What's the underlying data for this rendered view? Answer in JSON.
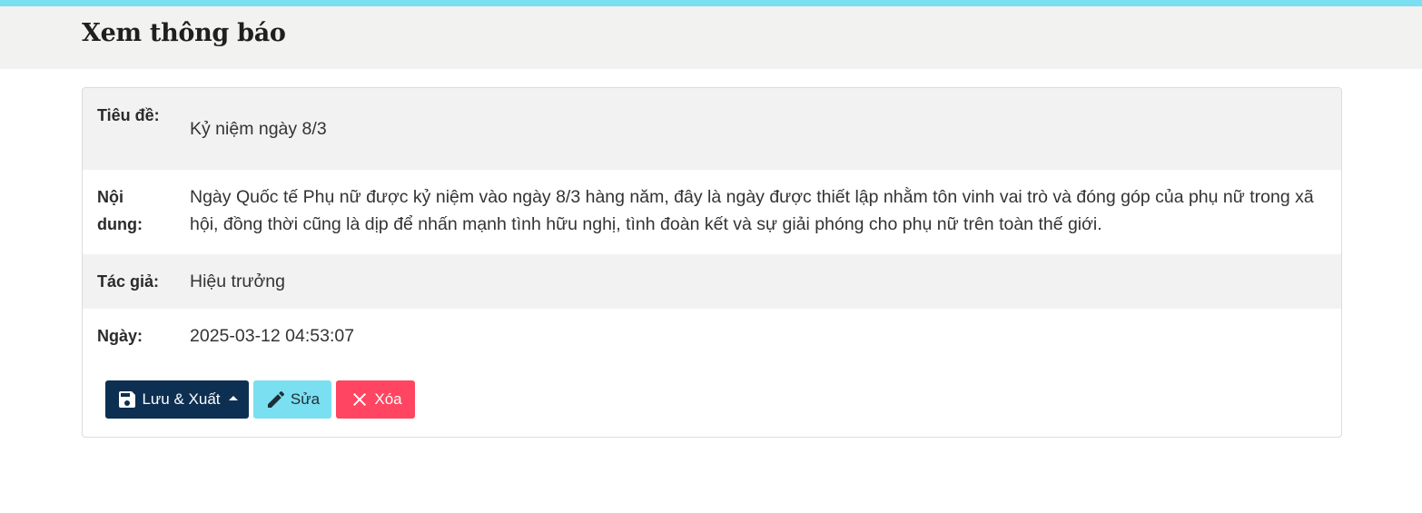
{
  "header": {
    "title": "Xem thông báo",
    "accent_color": "#7adff1"
  },
  "notice": {
    "rows": [
      {
        "label": "Tiêu đề:",
        "value": "Kỷ niệm ngày 8/3"
      },
      {
        "label": "Nội dung:",
        "value": "Ngày Quốc tế Phụ nữ được kỷ niệm vào ngày 8/3 hàng năm, đây là ngày được thiết lập nhằm tôn vinh vai trò và đóng góp của phụ nữ trong xã hội, đồng thời cũng là dịp để nhấn mạnh tình hữu nghị, tình đoàn kết và sự giải phóng cho phụ nữ trên toàn thế giới."
      },
      {
        "label": "Tác giả:",
        "value": "Hiệu trưởng"
      },
      {
        "label": "Ngày:",
        "value": "2025-03-12 04:53:07"
      }
    ]
  },
  "actions": {
    "save_export_label": "Lưu & Xuất",
    "edit_label": "Sửa",
    "delete_label": "Xóa",
    "icons": {
      "save": "floppy-disk-icon",
      "edit": "pencil-icon",
      "delete": "close-icon",
      "dropdown": "caret-up-icon"
    },
    "colors": {
      "save": "#0d2f52",
      "edit": "#7adff1",
      "delete": "#ff4561"
    }
  }
}
